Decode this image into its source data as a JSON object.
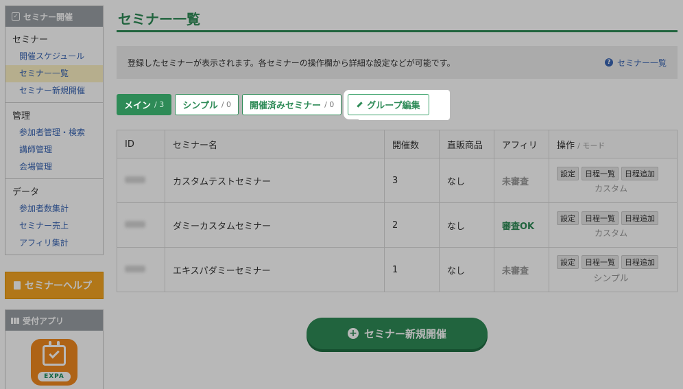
{
  "sidebar": {
    "header": "セミナー開催",
    "groups": [
      {
        "title": "セミナー",
        "items": [
          {
            "label": "開催スケジュール"
          },
          {
            "label": "セミナー一覧"
          },
          {
            "label": "セミナー新規開催"
          }
        ]
      },
      {
        "title": "管理",
        "items": [
          {
            "label": "参加者管理・検索"
          },
          {
            "label": "講師管理"
          },
          {
            "label": "会場管理"
          }
        ]
      },
      {
        "title": "データ",
        "items": [
          {
            "label": "参加者数集計"
          },
          {
            "label": "セミナー売上"
          },
          {
            "label": "アフィリ集計"
          }
        ]
      }
    ],
    "help_label": "セミナーヘルプ",
    "app_header": "受付アプリ",
    "app_icon_label": "EXPA"
  },
  "page": {
    "title": "セミナー一覧",
    "info_text": "登録したセミナーが表示されます。各セミナーの操作欄から詳細な設定などが可能です。",
    "info_link": "セミナー一覧"
  },
  "tabs": [
    {
      "label": "メイン",
      "count": "/ 3"
    },
    {
      "label": "シンプル",
      "count": "/ 0"
    },
    {
      "label": "開催済みセミナー",
      "count": "/ 0"
    }
  ],
  "group_edit_label": "グループ編集",
  "table": {
    "headers": {
      "id": "ID",
      "name": "セミナー名",
      "count": "開催数",
      "product": "直販商品",
      "affiliate": "アフィリ",
      "ops": "操作",
      "ops_sub": "/ モード"
    },
    "rows": [
      {
        "name": "カスタムテストセミナー",
        "count": "3",
        "product": "なし",
        "affiliate": "未審査",
        "mode": "カスタム"
      },
      {
        "name": "ダミーカスタムセミナー",
        "count": "2",
        "product": "なし",
        "affiliate": "審査OK",
        "mode": "カスタム"
      },
      {
        "name": "エキスパダミーセミナー",
        "count": "1",
        "product": "なし",
        "affiliate": "未審査",
        "mode": "シンプル"
      }
    ],
    "op_buttons": {
      "settings": "設定",
      "schedule_list": "日程一覧",
      "schedule_add": "日程追加"
    }
  },
  "new_button_label": "セミナー新規開催",
  "colors": {
    "accent": "#2e8b57",
    "help": "#f5a623",
    "link": "#3a66b5"
  }
}
